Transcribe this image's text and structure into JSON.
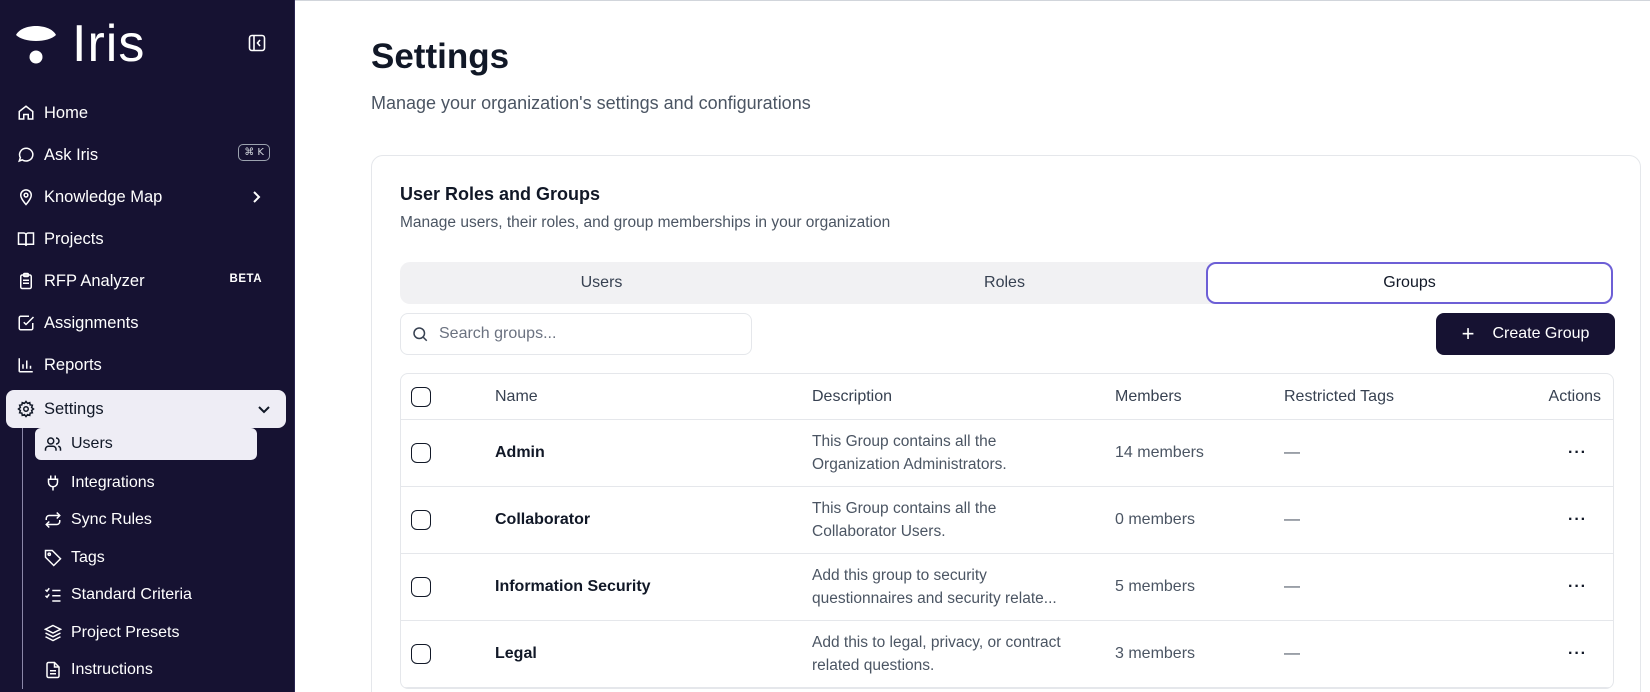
{
  "app": {
    "name": "Iris"
  },
  "sidebar": {
    "items": [
      {
        "label": "Home",
        "icon": "home-icon"
      },
      {
        "label": "Ask Iris",
        "icon": "chat-icon",
        "shortcut": "⌘ K"
      },
      {
        "label": "Knowledge Map",
        "icon": "map-pin-icon"
      },
      {
        "label": "Projects",
        "icon": "book-icon"
      },
      {
        "label": "RFP Analyzer",
        "icon": "clipboard-icon",
        "badge": "BETA"
      },
      {
        "label": "Assignments",
        "icon": "check-square-icon"
      },
      {
        "label": "Reports",
        "icon": "bar-chart-icon"
      },
      {
        "label": "Settings",
        "icon": "gear-icon",
        "active": true
      }
    ],
    "settings_sub": [
      {
        "label": "Users",
        "icon": "users-icon",
        "active": true
      },
      {
        "label": "Integrations",
        "icon": "plug-icon"
      },
      {
        "label": "Sync Rules",
        "icon": "sync-icon"
      },
      {
        "label": "Tags",
        "icon": "tag-icon"
      },
      {
        "label": "Standard Criteria",
        "icon": "checklist-icon"
      },
      {
        "label": "Project Presets",
        "icon": "layers-icon"
      },
      {
        "label": "Instructions",
        "icon": "document-icon"
      }
    ]
  },
  "page": {
    "title": "Settings",
    "subtitle": "Manage your organization's settings and configurations"
  },
  "card": {
    "title": "User Roles and Groups",
    "subtitle": "Manage users, their roles, and group memberships in your organization",
    "tabs": [
      {
        "label": "Users"
      },
      {
        "label": "Roles"
      },
      {
        "label": "Groups",
        "active": true
      }
    ],
    "search": {
      "placeholder": "Search groups...",
      "value": ""
    },
    "create_button": "Create Group",
    "table": {
      "headers": {
        "name": "Name",
        "description": "Description",
        "members": "Members",
        "tags": "Restricted Tags",
        "actions": "Actions"
      },
      "rows": [
        {
          "name": "Admin",
          "desc1": "This Group contains all the",
          "desc2": "Organization Administrators.",
          "members": "14 members",
          "tags": "—",
          "actions": "···"
        },
        {
          "name": "Collaborator",
          "desc1": "This Group contains all the",
          "desc2": "Collaborator Users.",
          "members": "0 members",
          "tags": "—",
          "actions": "···"
        },
        {
          "name": "Information Security",
          "desc1": "Add this group to security",
          "desc2": "questionnaires and security relate...",
          "members": "5 members",
          "tags": "—",
          "actions": "···"
        },
        {
          "name": "Legal",
          "desc1": "Add this to legal, privacy, or contract",
          "desc2": "related questions.",
          "members": "3 members",
          "tags": "—",
          "actions": "···"
        }
      ]
    }
  },
  "colors": {
    "sidebar_bg": "#161232",
    "accent": "#6d5fd6",
    "primary_button": "#161232"
  }
}
